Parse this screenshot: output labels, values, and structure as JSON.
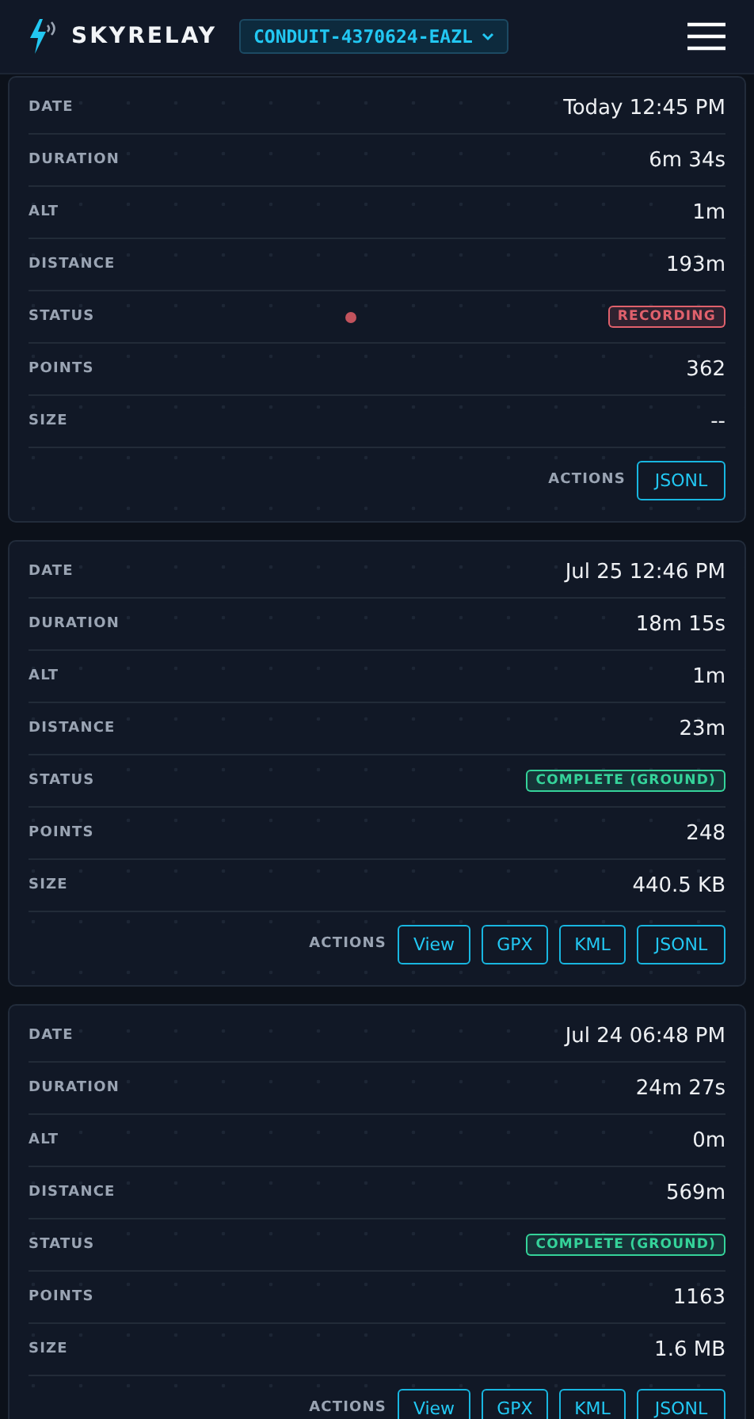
{
  "header": {
    "brand": "SKYRELAY",
    "device": "CONDUIT-4370624-EAZL"
  },
  "recordings": [
    {
      "rows": [
        {
          "kind": "text",
          "label": "DATE",
          "value": "Today 12:45 PM"
        },
        {
          "kind": "text",
          "label": "DURATION",
          "value": "6m 34s"
        },
        {
          "kind": "text",
          "label": "ALT",
          "value": "1m"
        },
        {
          "kind": "text",
          "label": "DISTANCE",
          "value": "193m"
        },
        {
          "kind": "status",
          "label": "STATUS",
          "value": "RECORDING",
          "color": "#e0616c",
          "live": true
        },
        {
          "kind": "text",
          "label": "POINTS",
          "value": "362"
        },
        {
          "kind": "text",
          "label": "SIZE",
          "value": "--"
        },
        {
          "kind": "actions",
          "label": "ACTIONS",
          "buttons": [
            "JSONL"
          ]
        }
      ]
    },
    {
      "rows": [
        {
          "kind": "text",
          "label": "DATE",
          "value": "Jul 25 12:46 PM"
        },
        {
          "kind": "text",
          "label": "DURATION",
          "value": "18m 15s"
        },
        {
          "kind": "text",
          "label": "ALT",
          "value": "1m"
        },
        {
          "kind": "text",
          "label": "DISTANCE",
          "value": "23m"
        },
        {
          "kind": "status",
          "label": "STATUS",
          "value": "COMPLETE (GROUND)",
          "color": "#35d39a",
          "live": false
        },
        {
          "kind": "text",
          "label": "POINTS",
          "value": "248"
        },
        {
          "kind": "text",
          "label": "SIZE",
          "value": "440.5 KB"
        },
        {
          "kind": "actions",
          "label": "ACTIONS",
          "buttons": [
            "View",
            "GPX",
            "KML",
            "JSONL"
          ]
        }
      ]
    },
    {
      "rows": [
        {
          "kind": "text",
          "label": "DATE",
          "value": "Jul 24 06:48 PM"
        },
        {
          "kind": "text",
          "label": "DURATION",
          "value": "24m 27s"
        },
        {
          "kind": "text",
          "label": "ALT",
          "value": "0m"
        },
        {
          "kind": "text",
          "label": "DISTANCE",
          "value": "569m"
        },
        {
          "kind": "status",
          "label": "STATUS",
          "value": "COMPLETE (GROUND)",
          "color": "#35d39a",
          "live": false
        },
        {
          "kind": "text",
          "label": "POINTS",
          "value": "1163"
        },
        {
          "kind": "text",
          "label": "SIZE",
          "value": "1.6 MB"
        },
        {
          "kind": "actions",
          "label": "ACTIONS",
          "buttons": [
            "View",
            "GPX",
            "KML",
            "JSONL"
          ]
        }
      ]
    }
  ]
}
